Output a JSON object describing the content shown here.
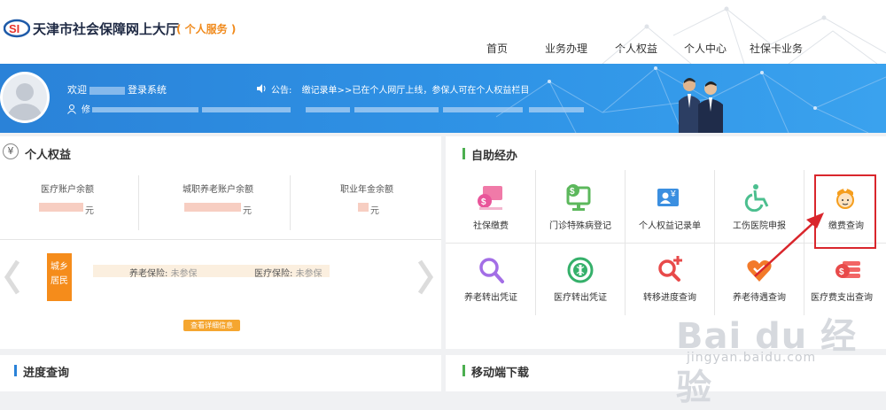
{
  "header": {
    "site_title": "天津市社会保障网上大厅",
    "site_subtitle": "( 个人服务 )",
    "nav": [
      "首页",
      "业务办理",
      "个人权益",
      "个人中心",
      "社保卡业务"
    ]
  },
  "banner": {
    "welcome_prefix": "欢迎",
    "welcome_suffix": "登录系统",
    "notice_label": "公告:",
    "notice_text": "缴记录单>>已在个人网厅上线，参保人可在个人权益栏目",
    "info_prefix": "修"
  },
  "personal_rights": {
    "title": "个人权益",
    "balances": [
      {
        "label": "医疗账户余额",
        "unit": "元"
      },
      {
        "label": "城职养老账户余额",
        "unit": "元"
      },
      {
        "label": "职业年金余额",
        "unit": "元"
      }
    ],
    "resident_label": "城乡居民",
    "pension_label": "养老保险:",
    "pension_value": "未参保",
    "medical_label": "医疗保险:",
    "medical_value": "未参保",
    "detail_button": "查看详细信息"
  },
  "self_service": {
    "title": "自助经办",
    "accent": "#4caf50",
    "row1": [
      {
        "label": "社保缴费",
        "icon": "payment-icon"
      },
      {
        "label": "门诊特殊病登记",
        "icon": "monitor-icon"
      },
      {
        "label": "个人权益记录单",
        "icon": "card-icon"
      },
      {
        "label": "工伤医院申报",
        "icon": "wheelchair-icon"
      },
      {
        "label": "缴费查询",
        "icon": "nurse-icon"
      }
    ],
    "row2": [
      {
        "label": "养老转出凭证",
        "icon": "search-icon"
      },
      {
        "label": "医疗转出凭证",
        "icon": "medical-icon"
      },
      {
        "label": "转移进度查询",
        "icon": "search-plus-icon"
      },
      {
        "label": "养老待遇查询",
        "icon": "heart-icon"
      },
      {
        "label": "医疗费支出查询",
        "icon": "coins-icon"
      }
    ]
  },
  "progress": {
    "title": "进度查询",
    "accent": "#2a82d8"
  },
  "mobile": {
    "title": "移动端下载",
    "accent": "#4caf50"
  },
  "watermark": {
    "main": "Bai du 经验",
    "sub": "jingyan.baidu.com"
  }
}
